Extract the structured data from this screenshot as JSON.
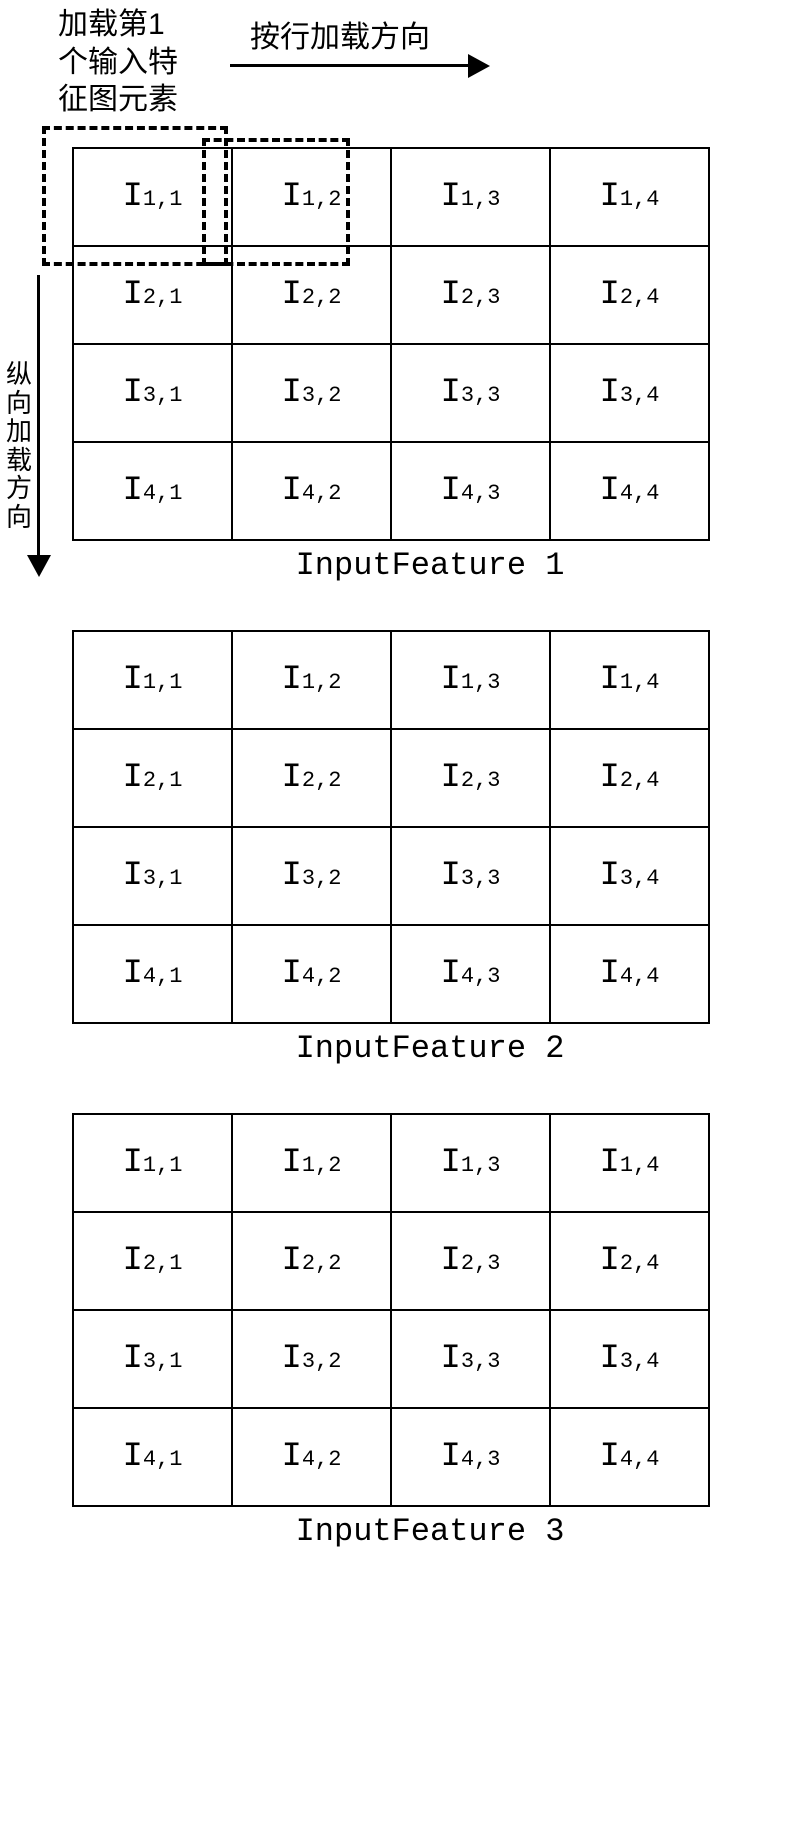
{
  "annot": {
    "top_left_line1": "加载第1",
    "top_left_line2": "个输入特",
    "top_left_line3": "征图元素",
    "row_dir": "按行加载方向",
    "col_dir": "纵向加载方向"
  },
  "features": [
    {
      "rows": [
        [
          {
            "base": "I",
            "sub": "1,1"
          },
          {
            "base": "I",
            "sub": "1,2"
          },
          {
            "base": "I",
            "sub": "1,3"
          },
          {
            "base": "I",
            "sub": "1,4"
          }
        ],
        [
          {
            "base": "I",
            "sub": "2,1"
          },
          {
            "base": "I",
            "sub": "2,2"
          },
          {
            "base": "I",
            "sub": "2,3"
          },
          {
            "base": "I",
            "sub": "2,4"
          }
        ],
        [
          {
            "base": "I",
            "sub": "3,1"
          },
          {
            "base": "I",
            "sub": "3,2"
          },
          {
            "base": "I",
            "sub": "3,3"
          },
          {
            "base": "I",
            "sub": "3,4"
          }
        ],
        [
          {
            "base": "I",
            "sub": "4,1"
          },
          {
            "base": "I",
            "sub": "4,2"
          },
          {
            "base": "I",
            "sub": "4,3"
          },
          {
            "base": "I",
            "sub": "4,4"
          }
        ]
      ],
      "caption": "InputFeature 1"
    },
    {
      "rows": [
        [
          {
            "base": "I",
            "sub": "1,1"
          },
          {
            "base": "I",
            "sub": "1,2"
          },
          {
            "base": "I",
            "sub": "1,3"
          },
          {
            "base": "I",
            "sub": "1,4"
          }
        ],
        [
          {
            "base": "I",
            "sub": "2,1"
          },
          {
            "base": "I",
            "sub": "2,2"
          },
          {
            "base": "I",
            "sub": "2,3"
          },
          {
            "base": "I",
            "sub": "2,4"
          }
        ],
        [
          {
            "base": "I",
            "sub": "3,1"
          },
          {
            "base": "I",
            "sub": "3,2"
          },
          {
            "base": "I",
            "sub": "3,3"
          },
          {
            "base": "I",
            "sub": "3,4"
          }
        ],
        [
          {
            "base": "I",
            "sub": "4,1"
          },
          {
            "base": "I",
            "sub": "4,2"
          },
          {
            "base": "I",
            "sub": "4,3"
          },
          {
            "base": "I",
            "sub": "4,4"
          }
        ]
      ],
      "caption": "InputFeature 2"
    },
    {
      "rows": [
        [
          {
            "base": "I",
            "sub": "1,1"
          },
          {
            "base": "I",
            "sub": "1,2"
          },
          {
            "base": "I",
            "sub": "1,3"
          },
          {
            "base": "I",
            "sub": "1,4"
          }
        ],
        [
          {
            "base": "I",
            "sub": "2,1"
          },
          {
            "base": "I",
            "sub": "2,2"
          },
          {
            "base": "I",
            "sub": "2,3"
          },
          {
            "base": "I",
            "sub": "2,4"
          }
        ],
        [
          {
            "base": "I",
            "sub": "3,1"
          },
          {
            "base": "I",
            "sub": "3,2"
          },
          {
            "base": "I",
            "sub": "3,3"
          },
          {
            "base": "I",
            "sub": "3,4"
          }
        ],
        [
          {
            "base": "I",
            "sub": "4,1"
          },
          {
            "base": "I",
            "sub": "4,2"
          },
          {
            "base": "I",
            "sub": "4,3"
          },
          {
            "base": "I",
            "sub": "4,4"
          }
        ]
      ],
      "caption": "InputFeature 3"
    }
  ]
}
